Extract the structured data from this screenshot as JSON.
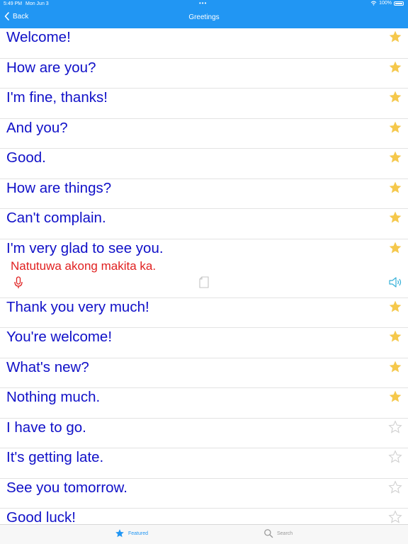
{
  "status": {
    "time": "5:49 PM",
    "date": "Mon Jun 3",
    "battery": "100%"
  },
  "nav": {
    "back_label": "Back",
    "title": "Greetings"
  },
  "phrases": [
    {
      "text": "Welcome!",
      "starred": true
    },
    {
      "text": "How are you?",
      "starred": true
    },
    {
      "text": "I'm fine, thanks!",
      "starred": true
    },
    {
      "text": "And you?",
      "starred": true
    },
    {
      "text": "Good.",
      "starred": true
    },
    {
      "text": "How are things?",
      "starred": true
    },
    {
      "text": "Can't complain.",
      "starred": true
    },
    {
      "text": "I'm very glad to see you.",
      "starred": true,
      "translation": "Natutuwa akong makita ka."
    },
    {
      "text": "Thank you very much!",
      "starred": true
    },
    {
      "text": "You're welcome!",
      "starred": true
    },
    {
      "text": "What's new?",
      "starred": true
    },
    {
      "text": "Nothing much.",
      "starred": true
    },
    {
      "text": "I have to go.",
      "starred": false
    },
    {
      "text": "It's getting late.",
      "starred": false
    },
    {
      "text": "See you tomorrow.",
      "starred": false
    },
    {
      "text": "Good luck!",
      "starred": false
    }
  ],
  "tabs": {
    "featured_label": "Featured",
    "search_label": "Search"
  },
  "colors": {
    "accent": "#2196f3",
    "phrase": "#1010c8",
    "translation": "#e02020",
    "star_filled": "#f5c84c",
    "star_empty": "#cfcfcf"
  }
}
